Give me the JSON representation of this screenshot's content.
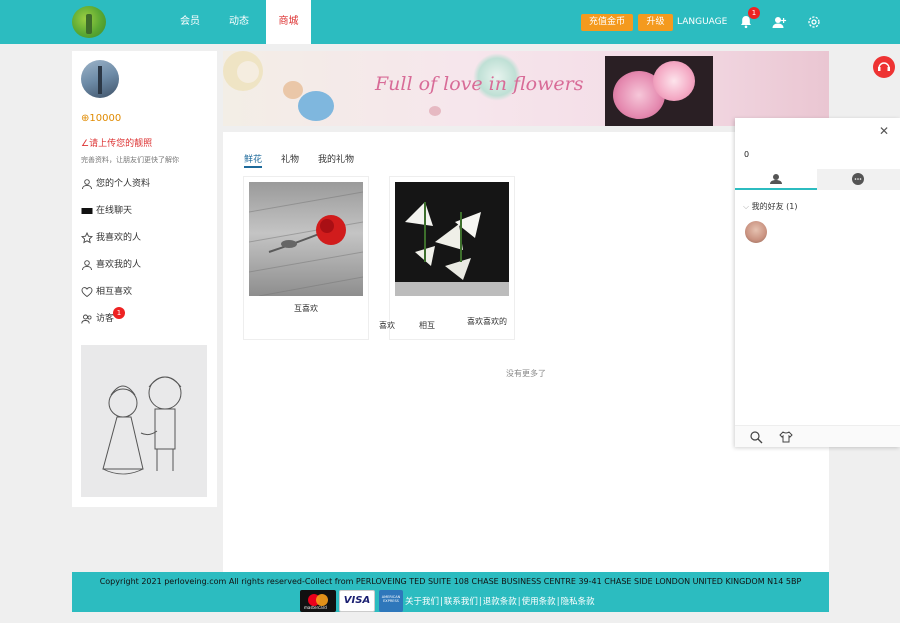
{
  "header": {
    "nav": [
      "会员",
      "动态",
      "商城"
    ],
    "active_nav": "商城",
    "recharge_label": "充值金币",
    "upgrade_label": "升级",
    "language_label": "LANGUAGE",
    "notification_count": "1"
  },
  "sidebar": {
    "coins": "10000",
    "upload_prompt": "请上传您的靓照",
    "profile_hint": "完善资料，让朋友们更快了解你",
    "menu": [
      {
        "label": "您的个人资料",
        "icon": "user-icon"
      },
      {
        "label": "在线聊天",
        "icon": "chat-icon"
      },
      {
        "label": "我喜欢的人",
        "icon": "star-icon"
      },
      {
        "label": "喜欢我的人",
        "icon": "user-icon"
      },
      {
        "label": "相互喜欢",
        "icon": "heart-icon"
      },
      {
        "label": "访客",
        "icon": "visitors-icon"
      }
    ],
    "visitor_badge": "1"
  },
  "banner": {
    "text": "Full of love in flowers"
  },
  "shop": {
    "tabs": [
      "鲜花",
      "礼物",
      "我的礼物"
    ],
    "active_tab": "鲜花",
    "products": [
      {
        "label": "互喜欢",
        "image": "red-rose-photo"
      },
      {
        "label": "",
        "image": "white-lily-photo"
      }
    ],
    "overlay_fragments": [
      "喜欢",
      "相互",
      "喜欢喜欢的"
    ],
    "no_more": "没有更多了"
  },
  "chat": {
    "count": "0",
    "group_label": "我的好友",
    "group_count": "(1)"
  },
  "footer": {
    "copyright": "Copyright 2021 perloveing.com All rights reserved-Collect from PERLOVEING TED SUITE 108 CHASE BUSINESS CENTRE 39-41 CHASE SIDE LONDON UNITED KINGDOM N14 5BP",
    "payment_cards": [
      "mastercard",
      "VISA",
      "AMERICAN EXPRESS"
    ],
    "links": [
      "关于我们",
      "联系我们",
      "退款条款",
      "使用条款",
      "隐私条款"
    ]
  },
  "colors": {
    "brand": "#2cbcc0",
    "accent_orange": "#f49a1e",
    "active_red": "#d33",
    "badge_red": "#e22"
  }
}
